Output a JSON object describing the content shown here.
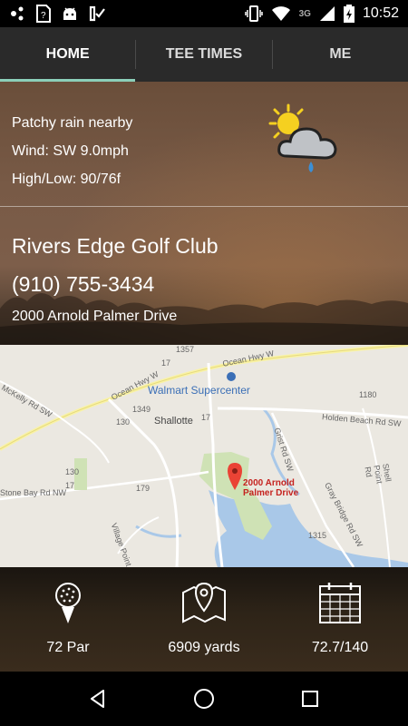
{
  "status_bar": {
    "time": "10:52",
    "network": "3G",
    "left_icons": [
      "notification-dots-icon",
      "sim-card-icon",
      "android-icon",
      "check-list-icon"
    ],
    "right_icons": [
      "vibrate-icon",
      "wifi-icon",
      "signal-icon",
      "battery-charging-icon"
    ]
  },
  "tabs": [
    {
      "label": "HOME",
      "active": true
    },
    {
      "label": "TEE TIMES",
      "active": false
    },
    {
      "label": "ME",
      "active": false
    }
  ],
  "weather": {
    "condition": "Patchy rain nearby",
    "wind": "Wind: SW 9.0mph",
    "high_low": "High/Low: 90/76f",
    "icon": "sun-cloud-rain-icon"
  },
  "club": {
    "name": "Rivers Edge Golf Club",
    "phone": "(910) 755-3434",
    "address": "2000 Arnold Palmer Drive"
  },
  "map": {
    "pin_label_line1": "2000 Arnold",
    "pin_label_line2": "Palmer Drive",
    "places": {
      "walmart": "Walmart Supercenter",
      "shallotte": "Shallotte"
    },
    "roads": {
      "ocean_hwy_w_1": "Ocean Hwy W",
      "ocean_hwy_w_2": "Ocean Hwy W",
      "holden_beach": "Holden Beach Rd SW",
      "gray_bridge": "Gray Bridge Rd SW",
      "village_point": "Village Point Rd",
      "mckelly": "McKelly Rd SW",
      "stone_bay": "Stone Bay Rd NW",
      "grist": "Grist Rd SW",
      "shell_point": "Shell Point Rd"
    },
    "route_numbers": {
      "r17a": "17",
      "r1357": "1357",
      "r1349": "1349",
      "r1180": "1180",
      "r130a": "130",
      "r17b": "17",
      "r179": "179",
      "r1315": "1315",
      "r130b": "130",
      "r17c": "17"
    }
  },
  "stats": [
    {
      "icon": "golf-ball-icon",
      "value": "72 Par"
    },
    {
      "icon": "map-pin-icon",
      "value": "6909 yards"
    },
    {
      "icon": "calendar-icon",
      "value": "72.7/140"
    }
  ],
  "nav": [
    "back-icon",
    "home-icon",
    "recents-icon"
  ]
}
